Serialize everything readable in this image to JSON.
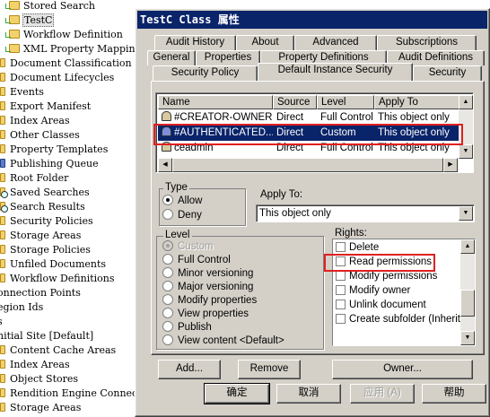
{
  "tree": {
    "items": [
      {
        "label": "Stored Search",
        "indent": 10,
        "icon": "folder-icon",
        "variant": ""
      },
      {
        "label": "TestC",
        "indent": 10,
        "icon": "folder-icon",
        "variant": "sel"
      },
      {
        "label": "Workflow Definition",
        "indent": 10,
        "icon": "folder-icon",
        "variant": ""
      },
      {
        "label": "XML Property Mapping",
        "indent": 10,
        "icon": "folder-icon",
        "variant": ""
      },
      {
        "label": "Document Classification",
        "indent": 0,
        "icon": "folder-icon",
        "variant": "half"
      },
      {
        "label": "Document Lifecycles",
        "indent": 0,
        "icon": "folder-icon",
        "variant": "half"
      },
      {
        "label": "Events",
        "indent": 0,
        "icon": "folder-icon",
        "variant": "half"
      },
      {
        "label": "Export Manifest",
        "indent": 0,
        "icon": "folder-icon",
        "variant": "half"
      },
      {
        "label": "Index Areas",
        "indent": 0,
        "icon": "folder-icon",
        "variant": "half"
      },
      {
        "label": "Other Classes",
        "indent": 0,
        "icon": "folder-icon",
        "variant": "half"
      },
      {
        "label": "Property Templates",
        "indent": 0,
        "icon": "folder-icon",
        "variant": "half"
      },
      {
        "label": "Publishing Queue",
        "indent": 0,
        "icon": "folder-icon",
        "variant": "blue"
      },
      {
        "label": "Root Folder",
        "indent": 0,
        "icon": "folder-icon",
        "variant": "half"
      },
      {
        "label": "Saved Searches",
        "indent": 0,
        "icon": "folder-icon",
        "variant": "mag"
      },
      {
        "label": "Search Results",
        "indent": 0,
        "icon": "folder-icon",
        "variant": "mag"
      },
      {
        "label": "Security Policies",
        "indent": 0,
        "icon": "folder-icon",
        "variant": "half"
      },
      {
        "label": "Storage Areas",
        "indent": 0,
        "icon": "folder-icon",
        "variant": "half"
      },
      {
        "label": "Storage Policies",
        "indent": 0,
        "icon": "folder-icon",
        "variant": "half"
      },
      {
        "label": "Unfiled Documents",
        "indent": 0,
        "icon": "folder-icon",
        "variant": "half"
      },
      {
        "label": "Workflow Definitions",
        "indent": 0,
        "icon": "folder-icon",
        "variant": "half"
      },
      {
        "label": "onnection Points",
        "indent": -4,
        "icon": "",
        "variant": "none"
      },
      {
        "label": "egion Ids",
        "indent": -4,
        "icon": "",
        "variant": "none"
      },
      {
        "label": "s",
        "indent": -4,
        "icon": "",
        "variant": "none"
      },
      {
        "label": "nitial Site [Default]",
        "indent": -4,
        "icon": "",
        "variant": "none"
      },
      {
        "label": "Content Cache Areas",
        "indent": 0,
        "icon": "folder-icon",
        "variant": "half"
      },
      {
        "label": "Index Areas",
        "indent": 0,
        "icon": "folder-icon",
        "variant": "half"
      },
      {
        "label": "Object Stores",
        "indent": 0,
        "icon": "folder-icon",
        "variant": "half"
      },
      {
        "label": "Rendition Engine Connec",
        "indent": 0,
        "icon": "folder-icon",
        "variant": "half"
      },
      {
        "label": "Storage Areas",
        "indent": 0,
        "icon": "folder-icon",
        "variant": "half"
      }
    ]
  },
  "dialog": {
    "title": "TestC Class 属性",
    "tabs_row1": [
      "Audit History",
      "About",
      "Advanced",
      "Subscriptions"
    ],
    "tabs_row2": [
      "General",
      "Properties",
      "Property Definitions",
      "Audit Definitions"
    ],
    "tabs_row3": [
      "Security Policy",
      "Default Instance Security",
      "Security"
    ],
    "active_tab": "Default Instance Security",
    "list": {
      "columns": [
        "Name",
        "Source",
        "Level",
        "Apply To"
      ],
      "rows": [
        {
          "name": "#CREATOR-OWNER",
          "source": "Direct",
          "level": "Full Control",
          "apply": "This object only",
          "icon": "user-icon"
        },
        {
          "name": "#AUTHENTICATED...",
          "source": "Direct",
          "level": "Custom",
          "apply": "This object only",
          "icon": "group-icon",
          "selected": true
        },
        {
          "name": "ceadmin",
          "source": "Direct",
          "level": "Full Control",
          "apply": "This object only",
          "icon": "user-icon"
        }
      ]
    },
    "type": {
      "label": "Type",
      "options": [
        "Allow",
        "Deny"
      ],
      "selected": "Allow"
    },
    "apply_to": {
      "label": "Apply To:",
      "value": "This object only"
    },
    "level": {
      "label": "Level",
      "options": [
        "Custom",
        "Full Control",
        "Minor versioning",
        "Major versioning",
        "Modify properties",
        "View properties",
        "Publish",
        "View content <Default>"
      ],
      "selected": "Custom"
    },
    "rights": {
      "label": "Rights:",
      "items": [
        "Delete",
        "Read permissions",
        "Modify permissions",
        "Modify owner",
        "Unlink document",
        "Create subfolder (Inherit Or"
      ]
    },
    "buttons": {
      "add": "Add...",
      "remove": "Remove",
      "owner": "Owner..."
    },
    "footer": {
      "ok": "确定",
      "cancel": "取消",
      "apply": "应用 (A)",
      "help": "帮助"
    },
    "colors": {
      "titlebar": "#0a246a",
      "face": "#d4d0c8",
      "highlight_box": "#e02020"
    }
  }
}
